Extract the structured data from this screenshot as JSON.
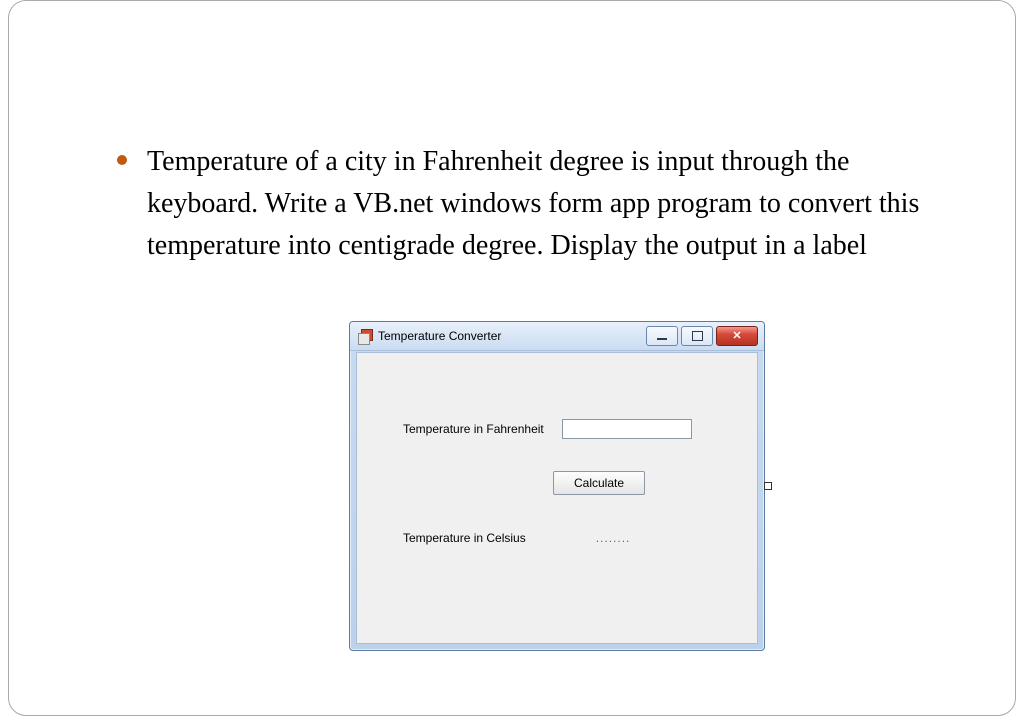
{
  "bullet": {
    "text": "Temperature of a city in Fahrenheit degree is input through the keyboard. Write a VB.net windows form app program to convert this temperature into centigrade degree. Display the output in a label"
  },
  "window": {
    "title": "Temperature Converter",
    "labels": {
      "fahrenheit": "Temperature in Fahrenheit",
      "celsius": "Temperature in Celsius"
    },
    "input": {
      "fahrenheit_value": ""
    },
    "output": {
      "celsius_value": "........"
    },
    "buttons": {
      "calculate": "Calculate"
    }
  }
}
